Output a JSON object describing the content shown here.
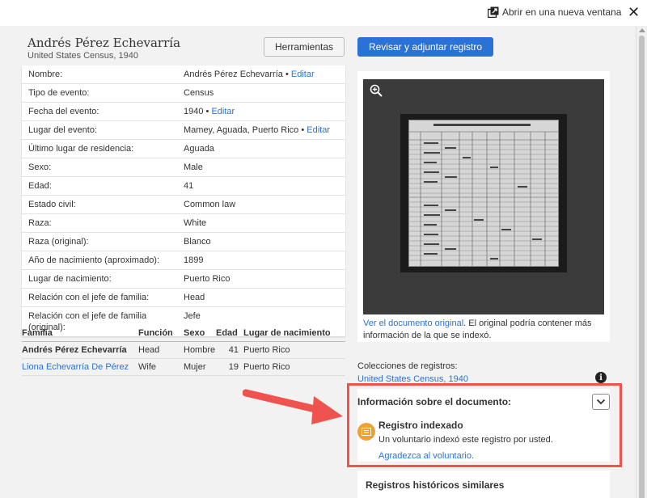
{
  "topbar": {
    "open_new_window": "Abrir en una nueva ventana",
    "close": "✕"
  },
  "record": {
    "name": "Andrés Pérez Echevarría",
    "collection": "United States Census, 1940"
  },
  "buttons": {
    "tools": "Herramientas",
    "review": "Revisar y adjuntar registro"
  },
  "facts": [
    {
      "label": "Nombre:",
      "value": "Andrés Pérez Echevarría •",
      "edit": "Editar"
    },
    {
      "label": "Tipo de evento:",
      "value": "Census",
      "edit": ""
    },
    {
      "label": "Fecha del evento:",
      "value": "1940 •",
      "edit": "Editar"
    },
    {
      "label": "Lugar del evento:",
      "value": "Mamey, Aguada, Puerto Rico •",
      "edit": "Editar"
    },
    {
      "label": "Último lugar de residencia:",
      "value": "Aguada",
      "edit": ""
    },
    {
      "label": "Sexo:",
      "value": "Male",
      "edit": ""
    },
    {
      "label": "Edad:",
      "value": "41",
      "edit": ""
    },
    {
      "label": "Estado civil:",
      "value": "Common law",
      "edit": ""
    },
    {
      "label": "Raza:",
      "value": "White",
      "edit": ""
    },
    {
      "label": "Raza (original):",
      "value": "Blanco",
      "edit": ""
    },
    {
      "label": "Año de nacimiento (aproximado):",
      "value": "1899",
      "edit": ""
    },
    {
      "label": "Lugar de nacimiento:",
      "value": "Puerto Rico",
      "edit": ""
    },
    {
      "label": "Relación con el jefe de familia:",
      "value": "Head",
      "edit": ""
    },
    {
      "label": "Relación con el jefe de familia (original):",
      "value": "Jefe",
      "edit": ""
    }
  ],
  "family": {
    "headers": {
      "name": "Familia",
      "role": "Función",
      "sex": "Sexo",
      "age": "Edad",
      "place": "Lugar de nacimiento"
    },
    "rows": [
      {
        "name": "Andrés Pérez Echevarría",
        "role": "Head",
        "sex": "Hombre",
        "age": "41",
        "place": "Puerto Rico"
      },
      {
        "name": "Liona Echevarría De Pérez",
        "role": "Wife",
        "sex": "Mujer",
        "age": "19",
        "place": "Puerto Rico"
      }
    ]
  },
  "image": {
    "view_original_link": "Ver el documento original",
    "caption_rest": ". El original podría contener más información de la que se indexó."
  },
  "collections": {
    "label": "Colecciones de registros:",
    "link": "United States Census, 1940",
    "info_glyph": "i"
  },
  "doc_info": {
    "title": "Información sobre el documento:",
    "indexed_title": "Registro indexado",
    "indexed_text": "Un voluntario indexó este registro por usted.",
    "thank_link": "Agradezca al voluntario."
  },
  "similar": {
    "title": "Registros históricos similares"
  },
  "colors": {
    "accent_blue": "#2a72d6",
    "highlight_red": "#ef5350",
    "indexed_orange": "#f0a033"
  }
}
